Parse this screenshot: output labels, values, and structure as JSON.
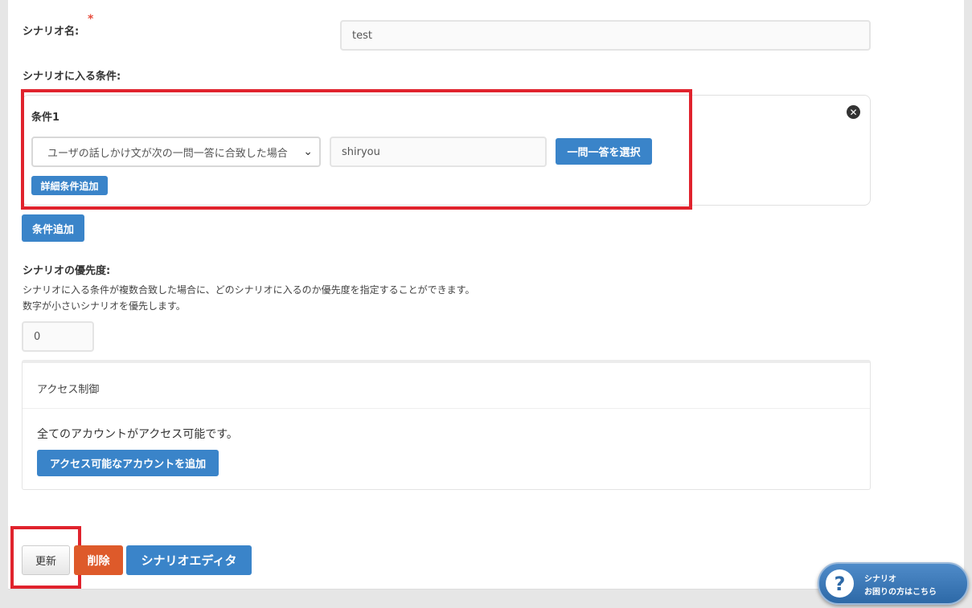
{
  "scenario_name": {
    "label": "シナリオ名:",
    "required_mark": "*",
    "value": "test"
  },
  "conditions": {
    "section_label": "シナリオに入る条件:",
    "items": [
      {
        "title": "条件1",
        "type_selected": "ユーザの話しかけ文が次の一問一答に合致した場合",
        "value": "shiryou",
        "select_button": "一問一答を選択",
        "detail_button": "詳細条件追加"
      }
    ],
    "add_button": "条件追加"
  },
  "priority": {
    "label": "シナリオの優先度:",
    "description_line1": "シナリオに入る条件が複数合致した場合に、どのシナリオに入るのか優先度を指定することができます。",
    "description_line2": "数字が小さいシナリオを優先します。",
    "value": "0"
  },
  "access_control": {
    "header": "アクセス制御",
    "message": "全てのアカウントがアクセス可能です。",
    "add_button": "アクセス可能なアカウントを追加"
  },
  "actions": {
    "update": "更新",
    "delete": "削除",
    "editor": "シナリオエディタ"
  },
  "help_widget": {
    "line1": "シナリオ",
    "line2": "お困りの方はこちら",
    "icon": "?"
  },
  "colors": {
    "primary": "#3a84c9",
    "danger": "#de5a2a",
    "highlight": "#e0232d"
  }
}
